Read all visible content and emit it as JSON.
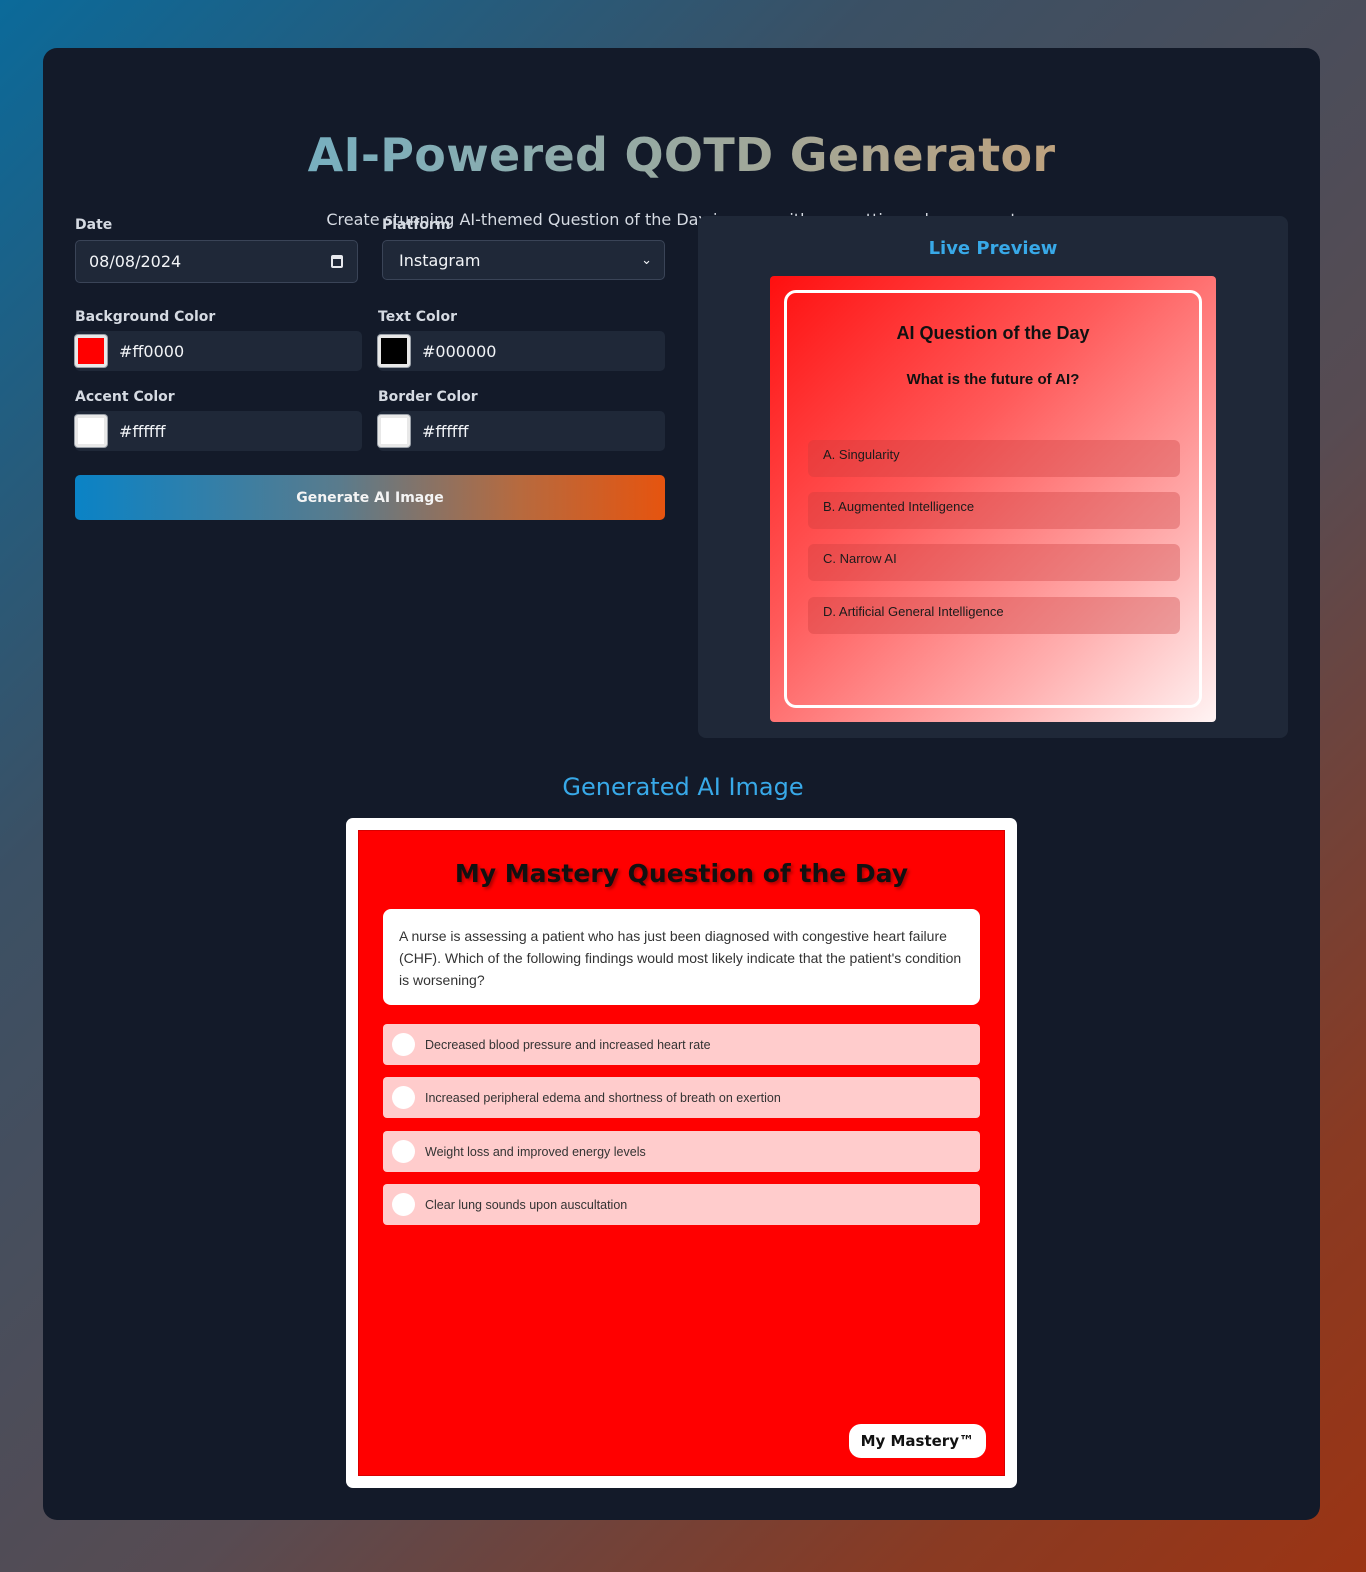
{
  "app": {
    "title": "AI-Powered QOTD Generator",
    "subtitle": "Create stunning AI-themed Question of the Day images with our cutting-edge generator."
  },
  "form": {
    "date_label": "Date",
    "date_value": "08/08/2024",
    "platform_label": "Platform",
    "platform_value": "Instagram",
    "bg_color_label": "Background Color",
    "bg_color_value": "#ff0000",
    "text_color_label": "Text Color",
    "text_color_value": "#000000",
    "accent_color_label": "Accent Color",
    "accent_color_value": "#ffffff",
    "border_color_label": "Border Color",
    "border_color_value": "#ffffff",
    "generate_button": "Generate AI Image"
  },
  "preview": {
    "heading": "Live Preview",
    "title": "AI Question of the Day",
    "question": "What is the future of AI?",
    "options": [
      "A. Singularity",
      "B. Augmented Intelligence",
      "C. Narrow AI",
      "D. Artificial General Intelligence"
    ]
  },
  "generated": {
    "heading": "Generated AI Image",
    "title": "My Mastery Question of the Day",
    "question": "A nurse is assessing a patient who has just been diagnosed with congestive heart failure (CHF). Which of the following findings would most likely indicate that the patient's condition is worsening?",
    "answers": [
      "Decreased blood pressure and increased heart rate",
      "Increased peripheral edema and shortness of breath on exertion",
      "Weight loss and improved energy levels",
      "Clear lung sounds upon auscultation"
    ],
    "brand": "My Mastery™"
  },
  "colors": {
    "background": "#ff0000",
    "text": "#000000",
    "accent": "#ffffff",
    "border": "#ffffff",
    "heading_blue": "#38a9e8"
  },
  "icons": {
    "date_picker": "calendar-icon",
    "platform_select": "chevron-down-icon"
  }
}
